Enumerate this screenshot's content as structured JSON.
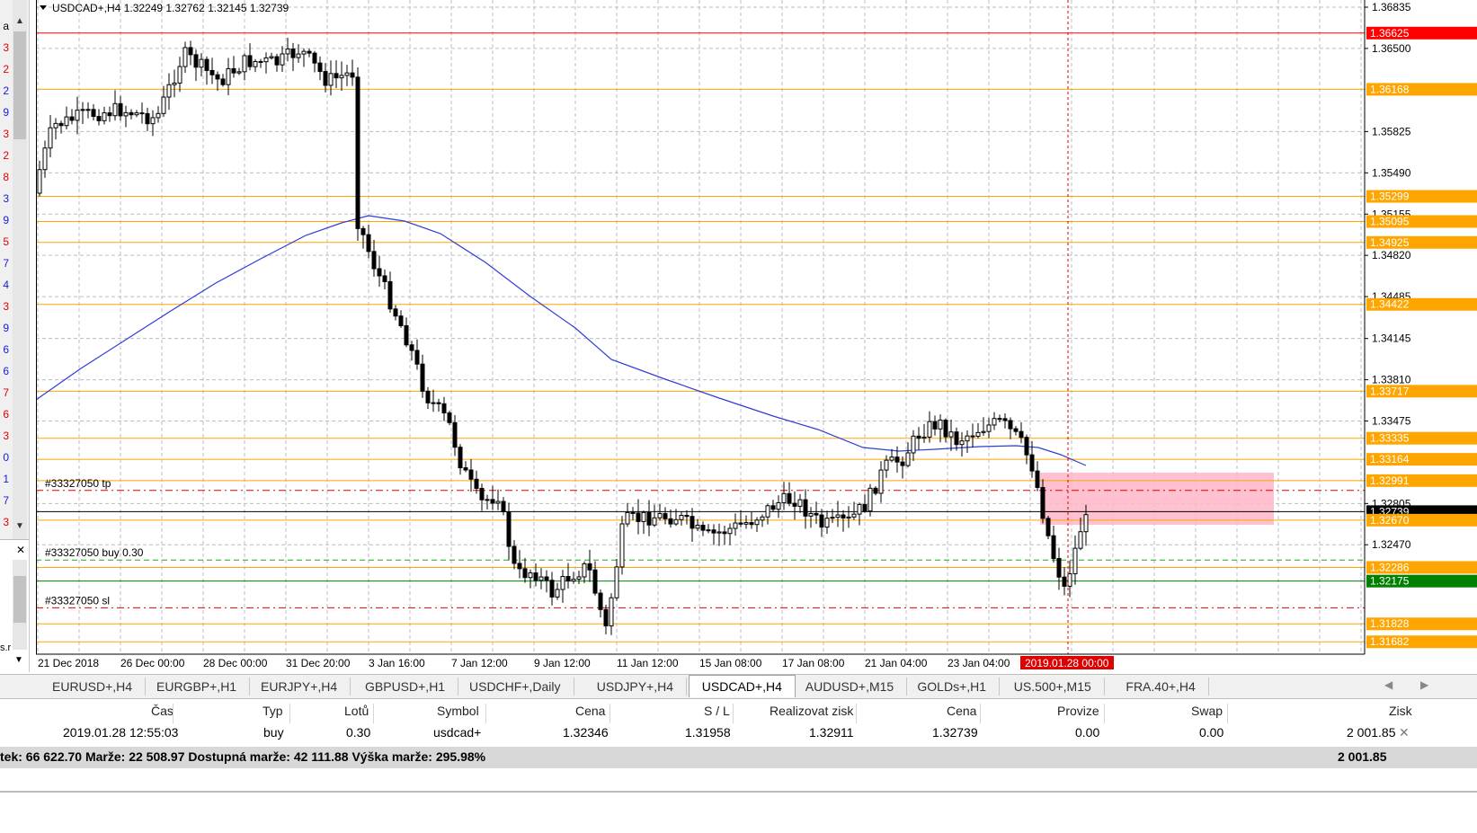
{
  "chart": {
    "header_text": "USDCAD+,H4  1.32249 1.32762 1.32145 1.32739",
    "price_scale": [
      "1.36835",
      "1.36500",
      "1.35825",
      "1.35490",
      "1.35155",
      "1.34820",
      "1.34485",
      "1.34145",
      "1.33810",
      "1.33475",
      "1.32805",
      "1.32470"
    ],
    "hlines": [
      {
        "label": "1.36625",
        "color": "#ff0000"
      },
      {
        "label": "1.36168",
        "color": "#ffa500"
      },
      {
        "label": "1.35299",
        "color": "#ffa500"
      },
      {
        "label": "1.35095",
        "color": "#ffa500"
      },
      {
        "label": "1.34925",
        "color": "#ffa500"
      },
      {
        "label": "1.34422",
        "color": "#ffa500"
      },
      {
        "label": "1.33717",
        "color": "#ffa500"
      },
      {
        "label": "1.33335",
        "color": "#ffa500"
      },
      {
        "label": "1.33164",
        "color": "#ffa500"
      },
      {
        "label": "1.32991",
        "color": "#ffa500"
      },
      {
        "label": "1.32739",
        "color": "#000000"
      },
      {
        "label": "1.32670",
        "color": "#ffa500"
      },
      {
        "label": "1.32286",
        "color": "#ffa500"
      },
      {
        "label": "1.32175",
        "color": "#008000"
      },
      {
        "label": "1.31828",
        "color": "#ffa500"
      },
      {
        "label": "1.31682",
        "color": "#ffa500"
      }
    ],
    "order_labels": [
      "#33327050 tp",
      "#33327050 buy 0.30",
      "#33327050 sl"
    ],
    "time_labels": [
      "21 Dec 2018",
      "26 Dec 00:00",
      "28 Dec 00:00",
      "31 Dec 20:00",
      "3 Jan 16:00",
      "7 Jan 12:00",
      "9 Jan 12:00",
      "11 Jan 12:00",
      "15 Jan 08:00",
      "17 Jan 08:00",
      "21 Jan 04:00",
      "23 Jan 04:00"
    ],
    "cursor_time_label": "2019.01.28 00:00",
    "ma_color": "#2f3cd8",
    "zone_color": "#ffb6c8"
  },
  "left_panel": {
    "digits": [
      {
        "t": "a",
        "c": "#000"
      },
      {
        "t": "3",
        "c": "#e00000"
      },
      {
        "t": "2",
        "c": "#e00000"
      },
      {
        "t": "2",
        "c": "#1a1ad6"
      },
      {
        "t": "9",
        "c": "#1a1ad6"
      },
      {
        "t": "3",
        "c": "#e00000"
      },
      {
        "t": "2",
        "c": "#e00000"
      },
      {
        "t": "8",
        "c": "#e00000"
      },
      {
        "t": "3",
        "c": "#1a1ad6"
      },
      {
        "t": "9",
        "c": "#1a1ad6"
      },
      {
        "t": "5",
        "c": "#e00000"
      },
      {
        "t": "7",
        "c": "#1a1ad6"
      },
      {
        "t": "4",
        "c": "#1a1ad6"
      },
      {
        "t": "3",
        "c": "#e00000"
      },
      {
        "t": "9",
        "c": "#1a1ad6"
      },
      {
        "t": "6",
        "c": "#1a1ad6"
      },
      {
        "t": "6",
        "c": "#1a1ad6"
      },
      {
        "t": "7",
        "c": "#e00000"
      },
      {
        "t": "6",
        "c": "#e00000"
      },
      {
        "t": "3",
        "c": "#e00000"
      },
      {
        "t": "0",
        "c": "#1a1ad6"
      },
      {
        "t": "1",
        "c": "#1a1ad6"
      },
      {
        "t": "7",
        "c": "#1a1ad6"
      },
      {
        "t": "3",
        "c": "#e00000"
      }
    ],
    "bottom_text": "s.r"
  },
  "tabs": {
    "items": [
      "EURUSD+,H4",
      "EURGBP+,H1",
      "EURJPY+,H4",
      "GBPUSD+,H1",
      "USDCHF+,Daily",
      "USDJPY+,H4",
      "USDCAD+,H4",
      "AUDUSD+,M15",
      "GOLDs+,H1",
      "US.500+,M15",
      "FRA.40+,H4"
    ],
    "active_index": 6
  },
  "terminal": {
    "headers": [
      "Čas",
      "Typ",
      "Lotů",
      "Symbol",
      "Cena",
      "S / L",
      "Realizovat zisk",
      "Cena",
      "Provize",
      "Swap",
      "Zisk"
    ],
    "row": [
      "2019.01.28 12:55:03",
      "buy",
      "0.30",
      "usdcad+",
      "1.32346",
      "1.31958",
      "1.32911",
      "1.32739",
      "0.00",
      "0.00",
      "2 001.85"
    ],
    "summary_text": "tek: 66 622.70  Marže: 22 508.97  Dostupná marže: 42 111.88  Výška marže: 295.98%",
    "summary_profit": "2 001.85"
  }
}
